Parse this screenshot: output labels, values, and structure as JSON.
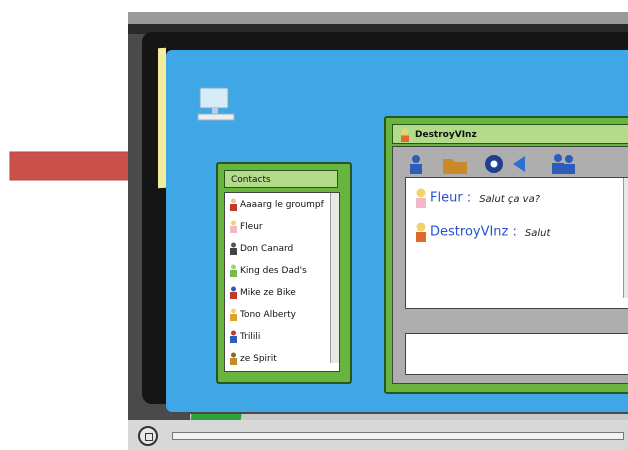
{
  "contacts_window": {
    "title": "Contacts",
    "items": [
      {
        "name": "Aaaarg le groumpf",
        "color": "#c0392b"
      },
      {
        "name": "Fleur",
        "color": "#f3b7c9"
      },
      {
        "name": "Don Canard",
        "color": "#444444"
      },
      {
        "name": "King des Dad's",
        "color": "#77b94d"
      },
      {
        "name": "Mike ze Bike",
        "color": "#c0392b"
      },
      {
        "name": "Tono Alberty",
        "color": "#e0a033"
      },
      {
        "name": "Trilili",
        "color": "#2d5db8"
      },
      {
        "name": "ze Spirit",
        "color": "#c28d2f"
      }
    ]
  },
  "chat_window": {
    "title": "DestroyVInz",
    "toolbar": [
      "person-icon",
      "folder-icon",
      "webcam-icon",
      "sound-icon",
      "group-icon"
    ],
    "messages": [
      {
        "sender": "Fleur :",
        "text": "Salut ça va?",
        "color": "#f3b7c9"
      },
      {
        "sender": "DestroyVInz :",
        "text": "Salut",
        "color": "#e06a2c"
      }
    ]
  },
  "colors": {
    "desktop": "#3fa7e6",
    "window_frame": "#67b43f",
    "window_title": "#b2db8a",
    "arrow": "#c9514a"
  }
}
